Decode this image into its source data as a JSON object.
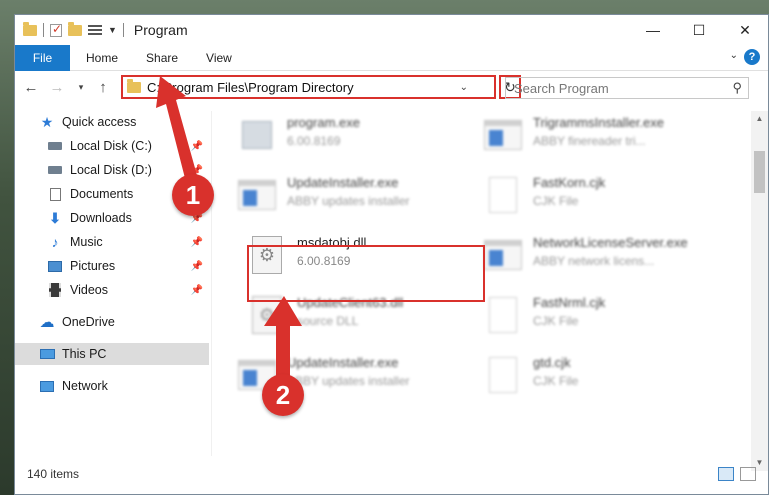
{
  "title": "Program",
  "ribbon": {
    "file": "File",
    "tabs": [
      "Home",
      "Share",
      "View"
    ]
  },
  "address": {
    "path": "C:\\Program Files\\Program Directory"
  },
  "search": {
    "placeholder": "Search Program"
  },
  "sidebar": {
    "items": [
      {
        "label": "Quick access",
        "icon": "star-icon"
      },
      {
        "label": "Local Disk (C:)",
        "icon": "drive-icon",
        "pinned": true
      },
      {
        "label": "Local Disk (D:)",
        "icon": "drive-icon",
        "pinned": true
      },
      {
        "label": "Documents",
        "icon": "documents-icon",
        "pinned": true
      },
      {
        "label": "Downloads",
        "icon": "download-icon",
        "pinned": true
      },
      {
        "label": "Music",
        "icon": "music-icon",
        "pinned": true
      },
      {
        "label": "Pictures",
        "icon": "pictures-icon",
        "pinned": true
      },
      {
        "label": "Videos",
        "icon": "videos-icon",
        "pinned": true
      },
      {
        "label": "OneDrive",
        "icon": "cloud-icon"
      },
      {
        "label": "This PC",
        "icon": "computer-icon",
        "selected": true
      },
      {
        "label": "Network",
        "icon": "network-icon"
      }
    ]
  },
  "files": [
    {
      "name": "program.exe",
      "sub": "6.00.8169",
      "icon": "program-exe-icon"
    },
    {
      "name": "TrigrammsInstaller.exe",
      "sub": "ABBY finereader tri...",
      "icon": "exe-icon"
    },
    {
      "name": "UpdateInstaller.exe",
      "sub": "ABBY updates installer",
      "icon": "exe-icon"
    },
    {
      "name": "FastKorn.cjk",
      "sub": "CJK File",
      "icon": "file-icon"
    },
    {
      "name": "msdatobj.dll",
      "sub": "6.00.8169",
      "icon": "dll-icon"
    },
    {
      "name": "NetworkLicenseServer.exe",
      "sub": "ABBY network licens...",
      "icon": "exe-icon"
    },
    {
      "name": "UpdateClient63.dll",
      "sub": "source DLL",
      "icon": "dll-icon"
    },
    {
      "name": "FastNrml.cjk",
      "sub": "CJK File",
      "icon": "file-icon"
    },
    {
      "name": "UpdateInstaller.exe",
      "sub": "ABBY updates installer",
      "icon": "exe-icon"
    },
    {
      "name": "gtd.cjk",
      "sub": "CJK File",
      "icon": "file-icon"
    }
  ],
  "status": {
    "count": "140 items"
  },
  "annotations": {
    "step1": "1",
    "step2": "2"
  },
  "colors": {
    "accent": "#1979ca",
    "highlight": "#d9312c",
    "selected": "#dcdcdc"
  }
}
